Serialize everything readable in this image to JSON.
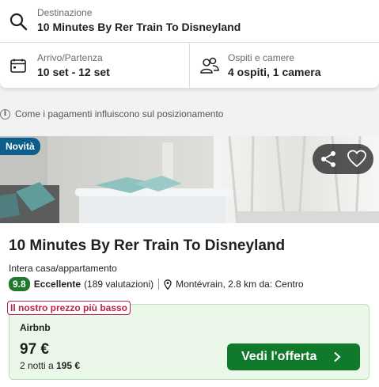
{
  "search": {
    "destination_label": "Destinazione",
    "destination_value": "10 Minutes By Rer Train To Disneyland",
    "dates_label": "Arrivo/Partenza",
    "dates_value": "10 set - 12 set",
    "guests_label": "Ospiti e camere",
    "guests_value": "4 ospiti, 1 camera"
  },
  "info": {
    "text": "Come i pagamenti influiscono sul posizionamento"
  },
  "listing": {
    "badge": "Novità",
    "name": "10 Minutes By Rer Train To Disneyland",
    "property_type": "Intera casa/appartamento",
    "score": "9.8",
    "score_word": "Eccellente",
    "reviews": "(189 valutazioni)",
    "location": "Montévrain, 2.8 km da: Centro",
    "lowest_price_badge": "Il nostro prezzo più basso",
    "provider": "Airbnb",
    "price": "97 €",
    "nights_prefix": "2 notti a",
    "nights_total": "195 €",
    "offer_button": "Vedi l'offerta"
  },
  "icons": {
    "search": "search-icon",
    "calendar": "calendar-icon",
    "guests": "people-icon",
    "info": "info-icon",
    "share": "share-icon",
    "favorite": "heart-icon",
    "location": "map-pin-icon",
    "chevron": "chevron-right-icon"
  },
  "colors": {
    "badge_new": "#0b5f8a",
    "score": "#1f7a2e",
    "deal_background": "#ebf8e9",
    "lowest_badge": "#b7224a",
    "offer_button": "#117a2a"
  }
}
